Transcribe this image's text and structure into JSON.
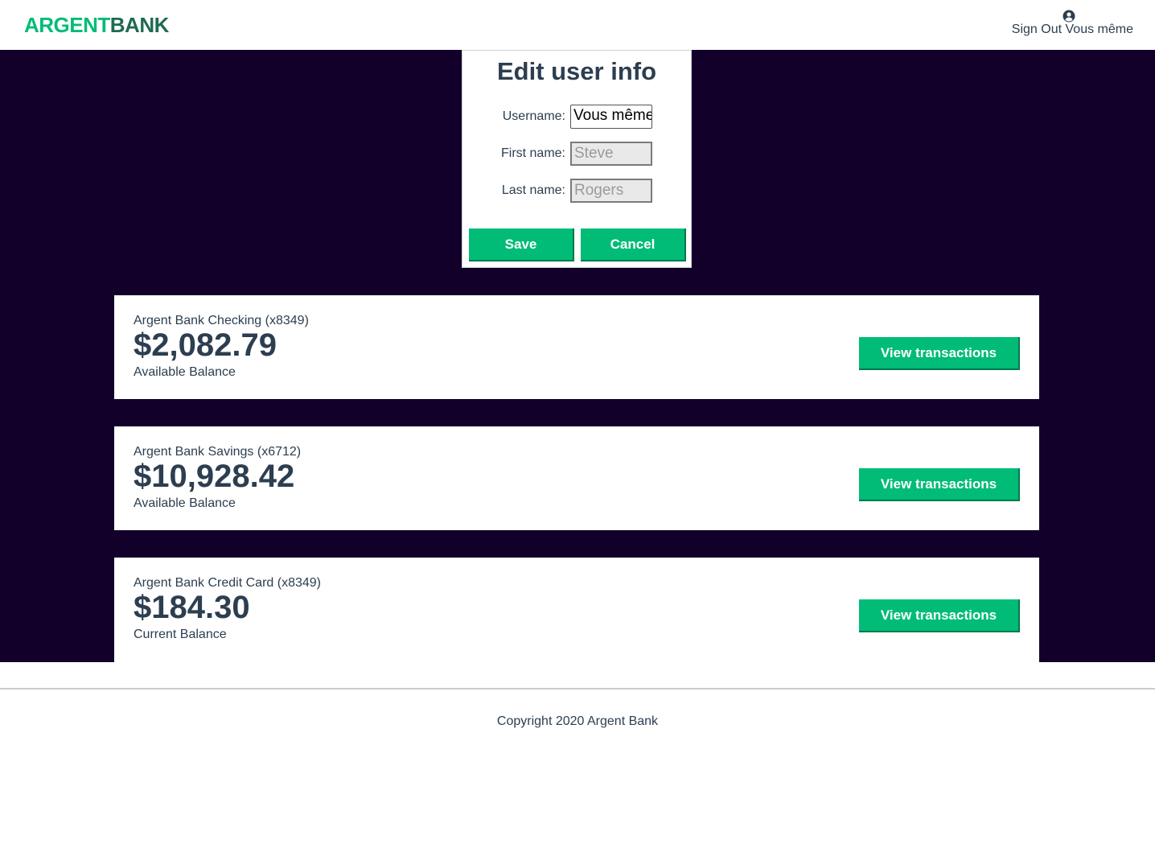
{
  "header": {
    "logo_part1": "ARGENT",
    "logo_part2": "BANK",
    "sign_out_label": "Sign Out",
    "username": "Vous même",
    "user_icon": "user-circle-icon"
  },
  "edit_form": {
    "title": "Edit user info",
    "username_label": "Username:",
    "username_value": "Vous même",
    "firstname_label": "First name:",
    "firstname_value": "Steve",
    "lastname_label": "Last name:",
    "lastname_value": "Rogers",
    "save_label": "Save",
    "cancel_label": "Cancel"
  },
  "accounts": [
    {
      "title": "Argent Bank Checking (x8349)",
      "amount": "$2,082.79",
      "description": "Available Balance",
      "button_label": "View transactions"
    },
    {
      "title": "Argent Bank Savings (x6712)",
      "amount": "$10,928.42",
      "description": "Available Balance",
      "button_label": "View transactions"
    },
    {
      "title": "Argent Bank Credit Card (x8349)",
      "amount": "$184.30",
      "description": "Current Balance",
      "button_label": "View transactions"
    }
  ],
  "footer": {
    "copyright": "Copyright 2020 Argent Bank"
  },
  "colors": {
    "brand_green": "#00bc77",
    "dark_green": "#1e6b52",
    "background_dark": "#12002b",
    "text": "#2c3e50"
  }
}
